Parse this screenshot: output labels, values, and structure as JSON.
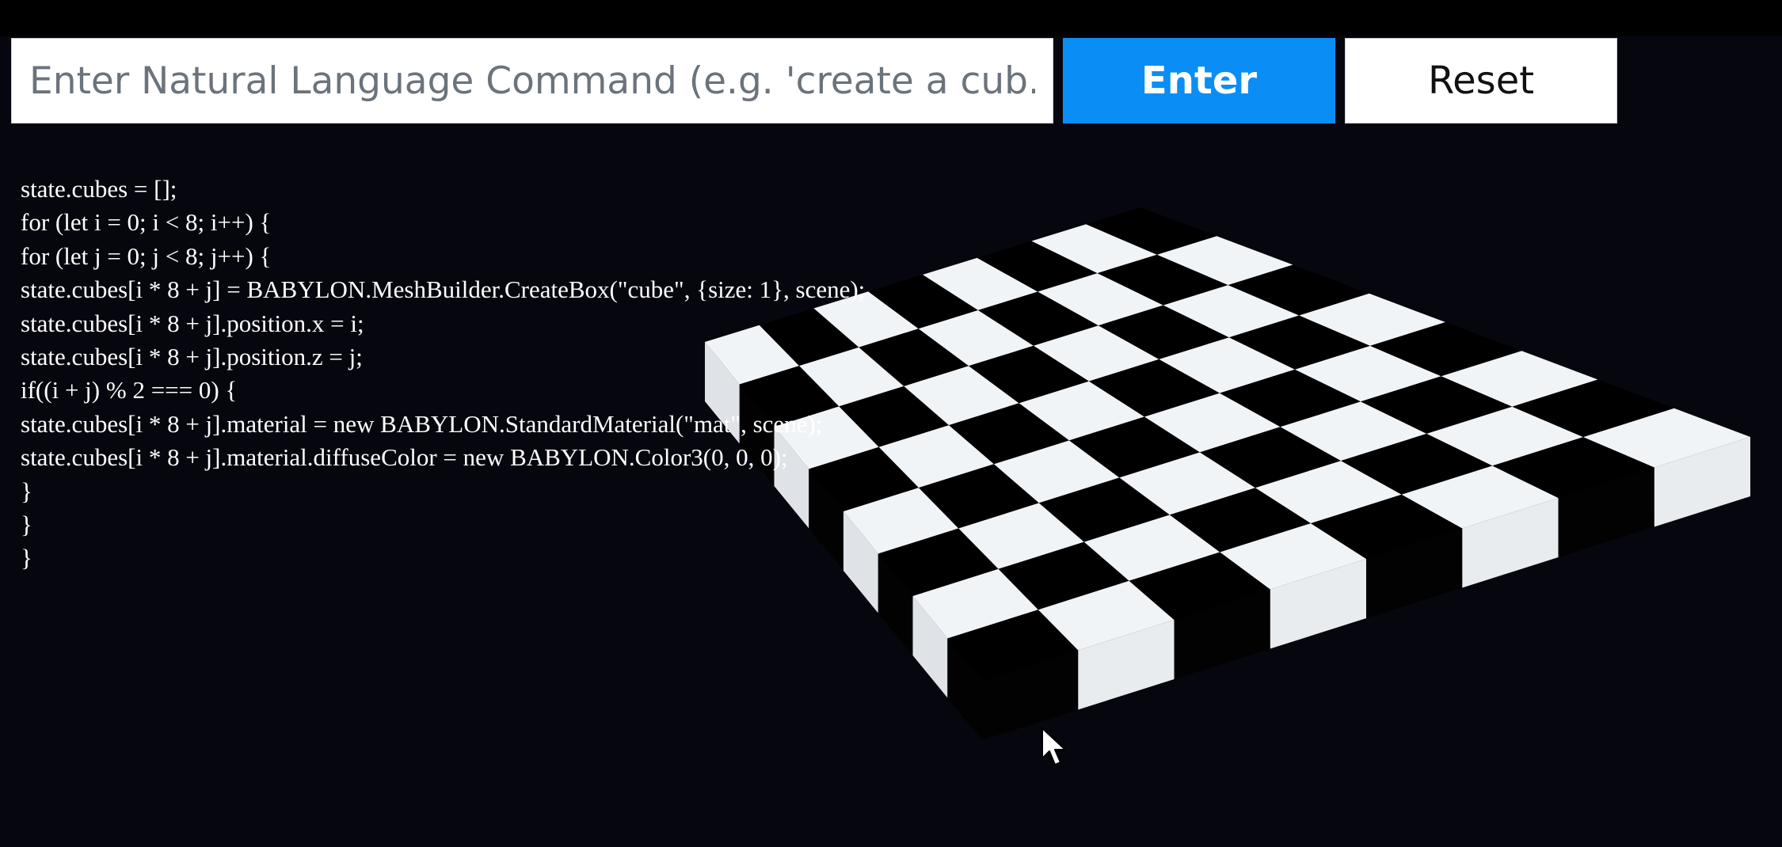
{
  "command_bar": {
    "placeholder": "Enter Natural Language Command (e.g. 'create a cub...",
    "value": "",
    "enter_label": "Enter",
    "reset_label": "Reset"
  },
  "code": {
    "lines": [
      "state.cubes = [];",
      "for (let i = 0; i < 8; i++) {",
      "for (let j = 0; j < 8; j++) {",
      "state.cubes[i * 8 + j] = BABYLON.MeshBuilder.CreateBox(\"cube\", {size: 1}, scene);",
      "state.cubes[i * 8 + j].position.x = i;",
      "state.cubes[i * 8 + j].position.z = j;",
      "if((i + j) % 2 === 0) {",
      "state.cubes[i * 8 + j].material = new BABYLON.StandardMaterial(\"mat\", scene);",
      "state.cubes[i * 8 + j].material.diffuseColor = new BABYLON.Color3(0, 0, 0);",
      "}",
      "}",
      "}"
    ]
  },
  "scene": {
    "board_rows": 8,
    "board_cols": 8,
    "light_color": "#f1f4f7",
    "dark_color": "#000000",
    "background": "#06060f"
  },
  "colors": {
    "accent": "#0a8ef6",
    "background": "#06060f",
    "topbar": "#000000"
  },
  "icons": {
    "cursor": "mouse-pointer-icon"
  }
}
